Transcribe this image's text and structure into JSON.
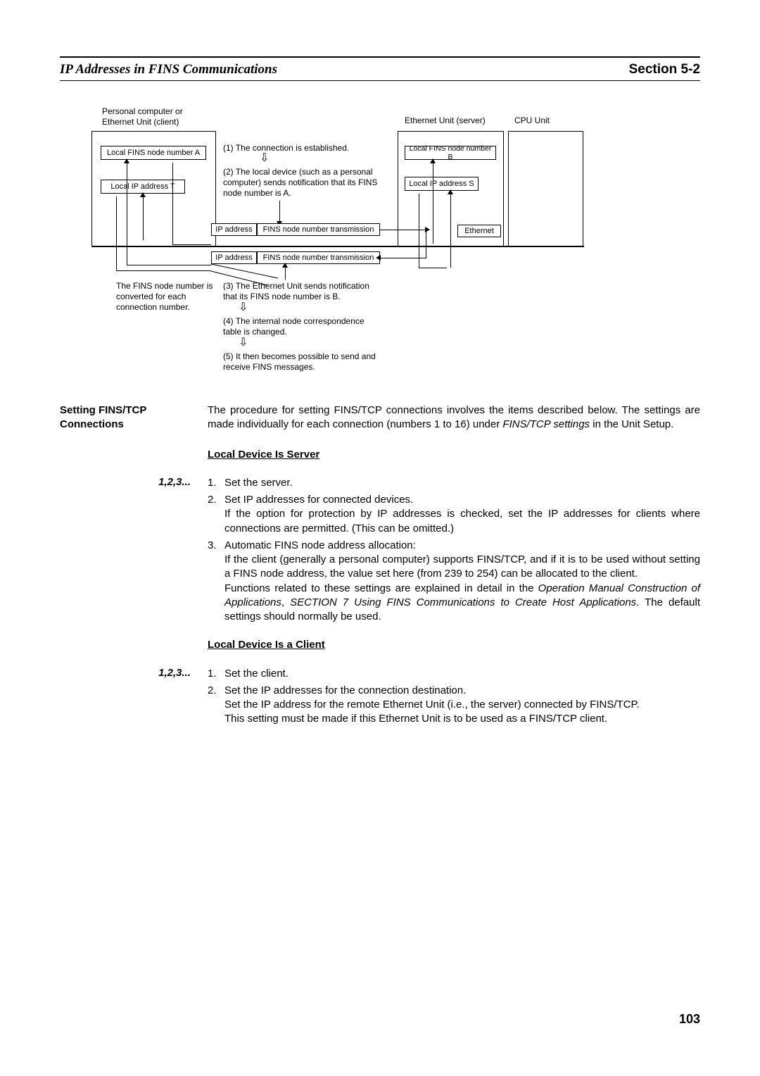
{
  "header": {
    "left": "IP Addresses in FINS Communications",
    "right": "Section 5-2"
  },
  "diagram": {
    "client_title": "Personal computer or\nEthernet Unit (client)",
    "server_title": "Ethernet Unit (server)",
    "cpu_title": "CPU Unit",
    "local_node_a": "Local FINS node number A",
    "local_ip_t": "Local IP address T",
    "local_node_b": "Local FINS node number B",
    "local_ip_s": "Local IP address S",
    "step1": "(1) The connection is established.",
    "step2": "(2) The local device (such as a personal computer) sends notification that its FINS node number is A.",
    "ip_addr": "IP address",
    "fins_trans": "FINS node number transmission",
    "ethernet": "Ethernet",
    "convert_note": "The FINS node number is converted for each connection number.",
    "step3": "(3) The Ethernet Unit sends notification that its FINS node number is B.",
    "step4": "(4) The internal node correspondence table is changed.",
    "step5": "(5) It then becomes possible to send and receive FINS messages."
  },
  "section": {
    "heading": "Setting FINS/TCP Connections",
    "intro_a": "The procedure for setting FINS/TCP connections involves the items described below. The settings are made individually for each connection (numbers 1 to 16) under ",
    "intro_em": "FINS/TCP settings",
    "intro_b": " in the Unit Setup.",
    "server_heading": "Local Device Is Server",
    "steps_marker": "1,2,3...",
    "server_steps": [
      {
        "num": "1.",
        "text": "Set the server."
      },
      {
        "num": "2.",
        "text": "Set IP addresses for connected devices.\nIf the option for protection by IP addresses is checked, set the IP addresses for clients where connections are permitted. (This can be omitted.)"
      },
      {
        "num": "3.",
        "text_a": "Automatic FINS node address allocation:\nIf the client (generally a personal computer) supports FINS/TCP, and if it is to be used without setting a FINS node address, the value set here (from 239 to 254) can be allocated to the client.\nFunctions related to these settings are explained in detail in the ",
        "em1": "Operation Manual Construction of Applications",
        "text_b": ", ",
        "em2": "SECTION 7 Using FINS Communications to Create Host Applications",
        "text_c": ". The default settings should normally be used."
      }
    ],
    "client_heading": "Local Device Is a Client",
    "client_steps": [
      {
        "num": "1.",
        "text": "Set the client."
      },
      {
        "num": "2.",
        "text": "Set the IP addresses for the connection destination.\nSet the IP address for the remote Ethernet Unit (i.e., the server) connected by FINS/TCP.\nThis setting must be made if this Ethernet Unit is to be used as a FINS/TCP client."
      }
    ]
  },
  "page_number": "103"
}
